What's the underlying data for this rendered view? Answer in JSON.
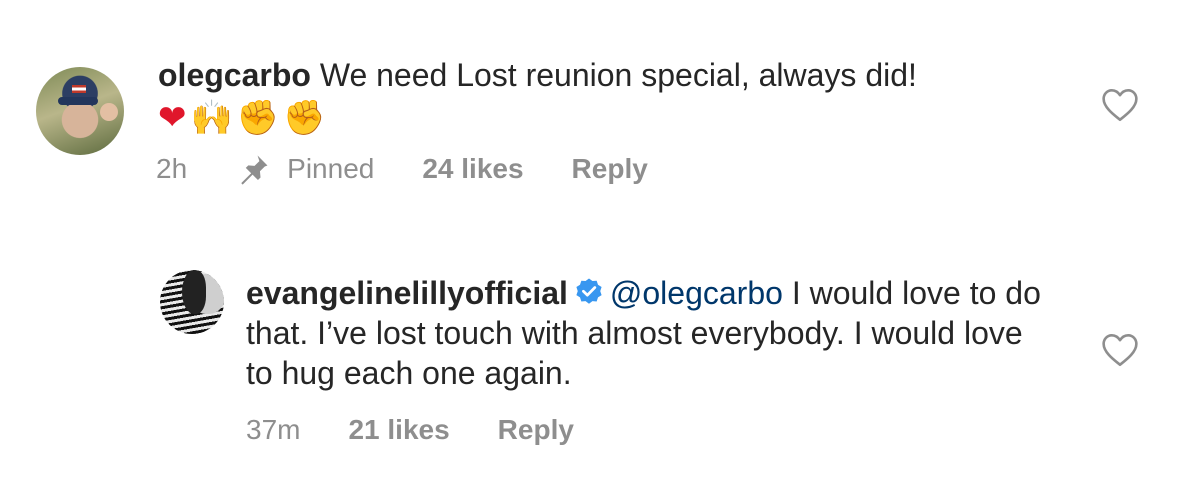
{
  "comments": [
    {
      "username": "olegcarbo",
      "text": " We need Lost reunion special, always did!",
      "emojis": [
        "❤",
        "🙌",
        "✊",
        "✊"
      ],
      "time": "2h",
      "pinned_label": "Pinned",
      "likes": "24 likes",
      "reply_label": "Reply"
    },
    {
      "username": "evangelinelillyofficial",
      "verified": true,
      "mention": "@olegcarbo",
      "text": " I would love to do that.  I’ve lost touch with almost everybody.  I would love to hug each one again.",
      "time": "37m",
      "likes": "21 likes",
      "reply_label": "Reply"
    }
  ],
  "colors": {
    "text": "#262626",
    "muted": "#8e8e8e",
    "mention": "#00376b",
    "verified": "#3897f0",
    "heart_emoji": "#e0162b"
  },
  "icons": {
    "like": "heart-outline-icon",
    "pin": "pin-icon",
    "verified": "verified-badge-icon"
  }
}
